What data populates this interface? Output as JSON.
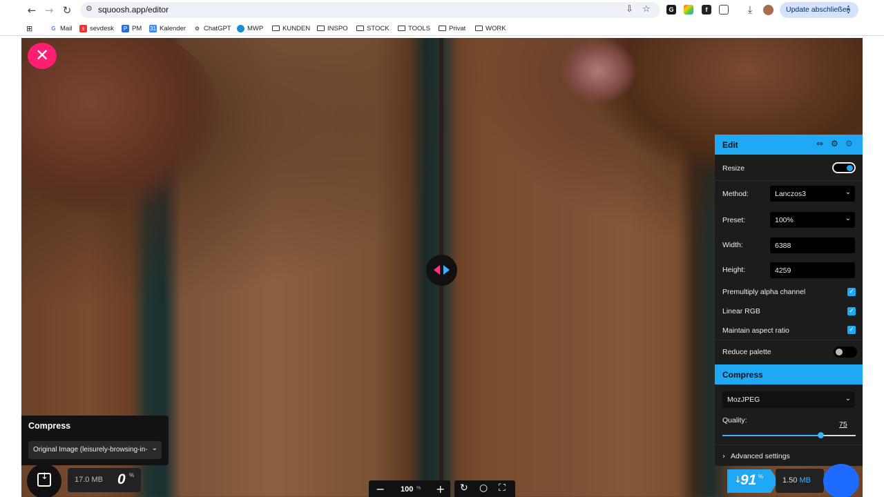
{
  "browser": {
    "url": "squoosh.app/editor",
    "update_label": "Update abschließen",
    "bookmarks": [
      {
        "label": "Mail",
        "icon": "google-icon"
      },
      {
        "label": "sevdesk",
        "icon": "sevdesk-icon"
      },
      {
        "label": "PM",
        "icon": "pm-icon"
      },
      {
        "label": "Kalender",
        "icon": "calendar-icon"
      },
      {
        "label": "ChatGPT",
        "icon": "chatgpt-icon"
      },
      {
        "label": "MWP",
        "icon": "mwp-icon"
      },
      {
        "label": "KUNDEN",
        "icon": "folder-icon"
      },
      {
        "label": "INSPO",
        "icon": "folder-icon"
      },
      {
        "label": "STOCK",
        "icon": "folder-icon"
      },
      {
        "label": "TOOLS",
        "icon": "folder-icon"
      },
      {
        "label": "Privat",
        "icon": "folder-icon"
      },
      {
        "label": "WORK",
        "icon": "folder-icon"
      }
    ]
  },
  "left_panel": {
    "title": "Compress",
    "selected_option": "Original Image (leisurely-browsing-in-",
    "size": "17.0 MB",
    "percent": "0",
    "percent_unit": "%"
  },
  "zoom": {
    "value": "100",
    "unit": "%"
  },
  "edit_panel": {
    "title": "Edit",
    "resize_label": "Resize",
    "method_label": "Method:",
    "method_value": "Lanczos3",
    "preset_label": "Preset:",
    "preset_value": "100%",
    "width_label": "Width:",
    "width_value": "6388",
    "height_label": "Height:",
    "height_value": "4259",
    "premultiply_label": "Premultiply alpha channel",
    "linear_rgb_label": "Linear RGB",
    "aspect_label": "Maintain aspect ratio",
    "reduce_palette_label": "Reduce palette"
  },
  "compress_panel": {
    "title": "Compress",
    "codec": "MozJPEG",
    "quality_label": "Quality:",
    "quality_value": "75",
    "advanced_label": "Advanced settings"
  },
  "result": {
    "reduction": "91",
    "reduction_unit": "%",
    "size_value": "1.50",
    "size_unit": "MB"
  },
  "colors": {
    "accent_blue": "#1fa8f4",
    "accent_pink": "#ff1f72"
  }
}
